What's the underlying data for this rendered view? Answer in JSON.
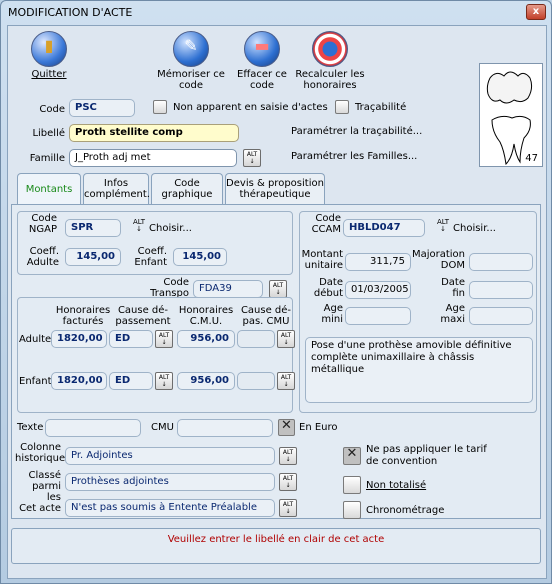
{
  "window": {
    "title": "MODIFICATION D'ACTE",
    "close": "x"
  },
  "toolbar": {
    "quit": "Quitter",
    "save": [
      "Mémoriser ce",
      "code"
    ],
    "delete": [
      "Effacer ce",
      "code"
    ],
    "recalc": [
      "Recalculer les",
      "honoraires"
    ]
  },
  "form": {
    "code_label": "Code",
    "code_value": "PSC",
    "non_apparent": "Non apparent en saisie d'actes",
    "tracabilite": "Traçabilité",
    "libelle_label": "Libellé",
    "libelle_value": "Proth stellite comp",
    "param_trac": "Paramétrer la traçabilité...",
    "famille_label": "Famille",
    "famille_value": "J_Proth adj met",
    "param_fam": "Paramétrer les Familles..."
  },
  "tooth": {
    "number": "47"
  },
  "tabs": [
    {
      "label": "Montants"
    },
    {
      "label": "Infos complément."
    },
    {
      "label": "Code graphique"
    },
    {
      "label": "Devis & proposition thérapeutique"
    }
  ],
  "ngap": {
    "code_label": "Code NGAP",
    "code_value": "SPR",
    "choisir": "Choisir...",
    "coeff_adulte_label": "Coeff. Adulte",
    "coeff_adulte": "145,00",
    "coeff_enfant_label": "Coeff. Enfant",
    "coeff_enfant": "145,00",
    "transpo_label": "Code Transpo",
    "transpo_value": "FDA39",
    "col_hon": "Honoraires facturés",
    "col_cause": "Cause dé-passement",
    "col_cmu": "Honoraires C.M.U.",
    "col_cause_cmu": "Cause dé-pas. CMU",
    "adulte_label": "Adulte",
    "adulte_hon": "1820,00",
    "adulte_cause": "ED",
    "adulte_cmu": "956,00",
    "enfant_label": "Enfant",
    "enfant_hon": "1820,00",
    "enfant_cause": "ED",
    "enfant_cmu": "956,00"
  },
  "ccam": {
    "code_label": "Code CCAM",
    "code_value": "HBLD047",
    "choisir": "Choisir...",
    "montant_label": "Montant unitaire",
    "montant": "311,75",
    "majoration_label": "Majoration DOM",
    "date_debut_label": "Date début",
    "date_debut": "01/03/2005",
    "date_fin_label": "Date fin",
    "age_mini_label": "Age mini",
    "age_maxi_label": "Age maxi",
    "description": "Pose d'une prothèse amovible définitive complète unimaxillaire à châssis métallique"
  },
  "bottom": {
    "texte_label": "Texte",
    "cmu_label": "CMU",
    "en_euro": "En Euro",
    "colonne_label": "Colonne historique",
    "colonne_value": "Pr. Adjointes",
    "classe_label": "Classé parmi les",
    "classe_value": "Prothèses adjointes",
    "cet_acte_label": "Cet acte",
    "cet_acte_value": "N'est pas soumis à Entente Préalable",
    "ne_pas_appliquer": "Ne pas appliquer le tarif de convention",
    "non_totalise": "Non totalisé",
    "chrono": "Chronométrage"
  },
  "status": {
    "message": "Veuillez entrer le libellé en clair de cet acte"
  }
}
